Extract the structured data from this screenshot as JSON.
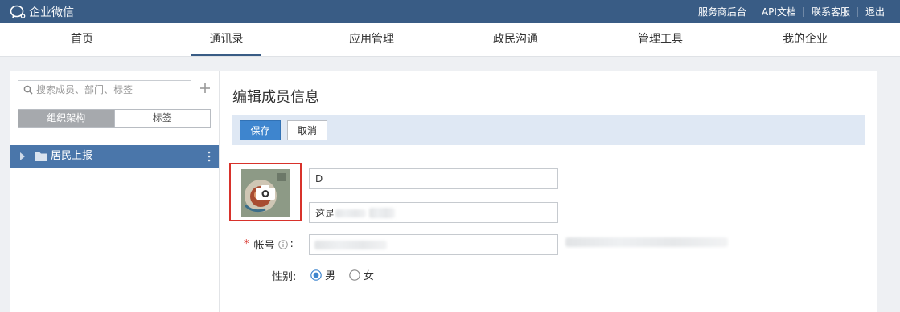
{
  "app": {
    "title": "企业微信",
    "top_links": [
      "服务商后台",
      "API文档",
      "联系客服",
      "退出"
    ]
  },
  "nav": {
    "items": [
      "首页",
      "通讯录",
      "应用管理",
      "政民沟通",
      "管理工具",
      "我的企业"
    ],
    "active": "通讯录"
  },
  "sidebar": {
    "search_placeholder": "搜索成员、部门、标签",
    "tabs": [
      "组织架构",
      "标签"
    ],
    "active_tab": "组织架构",
    "tree": [
      {
        "label": "居民上报",
        "selected": true
      }
    ]
  },
  "main": {
    "title": "编辑成员信息",
    "save_label": "保存",
    "cancel_label": "取消",
    "name_value": "D",
    "alias_value": "这是",
    "account_label": "帐号",
    "gender_label": "性别:",
    "gender_options": [
      "男",
      "女"
    ],
    "gender_selected": "男"
  },
  "colors": {
    "topbar": "#395c85",
    "accent": "#3e85ce",
    "tree_selected": "#4a76aa",
    "highlight_box": "#d8322b",
    "toolbar_bg": "#dfe8f4"
  },
  "icons": [
    "wecom-logo-icon",
    "search-icon",
    "plus-icon",
    "caret-right-icon",
    "folder-icon",
    "more-vertical-icon",
    "camera-icon",
    "info-icon",
    "radio-icon"
  ]
}
